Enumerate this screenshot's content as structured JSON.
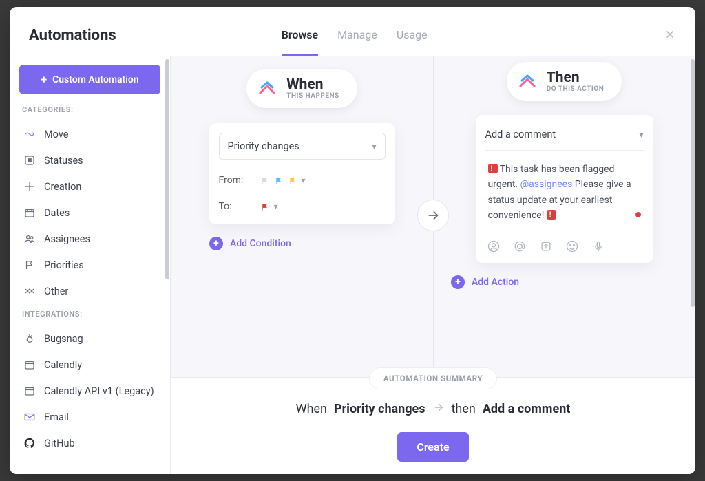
{
  "header": {
    "title": "Automations",
    "tabs": [
      {
        "label": "Browse",
        "active": true
      },
      {
        "label": "Manage",
        "active": false
      },
      {
        "label": "Usage",
        "active": false
      }
    ]
  },
  "sidebar": {
    "custom_button": "Custom Automation",
    "categories_label": "CATEGORIES:",
    "categories": [
      {
        "label": "Move",
        "icon": "move-icon"
      },
      {
        "label": "Statuses",
        "icon": "status-icon"
      },
      {
        "label": "Creation",
        "icon": "creation-icon"
      },
      {
        "label": "Dates",
        "icon": "calendar-icon"
      },
      {
        "label": "Assignees",
        "icon": "assignees-icon"
      },
      {
        "label": "Priorities",
        "icon": "flag-icon"
      },
      {
        "label": "Other",
        "icon": "other-icon"
      }
    ],
    "integrations_label": "INTEGRATIONS:",
    "integrations": [
      {
        "label": "Bugsnag",
        "icon": "bugsnag-icon"
      },
      {
        "label": "Calendly",
        "icon": "calendly-icon"
      },
      {
        "label": "Calendly API v1 (Legacy)",
        "icon": "calendly-legacy-icon"
      },
      {
        "label": "Email",
        "icon": "email-icon"
      },
      {
        "label": "GitHub",
        "icon": "github-icon"
      }
    ]
  },
  "builder": {
    "when": {
      "title": "When",
      "subtitle": "THIS HAPPENS",
      "trigger_label": "Priority changes",
      "from_label": "From:",
      "to_label": "To:",
      "from_priorities": [
        "none",
        "blue",
        "yellow"
      ],
      "to_priorities": [
        "red"
      ],
      "add_condition": "Add Condition"
    },
    "then": {
      "title": "Then",
      "subtitle": "DO THIS ACTION",
      "action_label": "Add a comment",
      "comment_text_pre": "This task has been flagged urgent. ",
      "comment_mention": "@assignees",
      "comment_text_post": " Please give a status update at your earliest convenience! ",
      "add_action": "Add Action"
    }
  },
  "summary": {
    "label": "AUTOMATION SUMMARY",
    "when_prefix": "When",
    "when_value": "Priority changes",
    "then_prefix": "then",
    "then_value": "Add a comment"
  },
  "footer": {
    "create": "Create"
  },
  "colors": {
    "accent": "#7b68ee",
    "red": "#e03d3d"
  }
}
